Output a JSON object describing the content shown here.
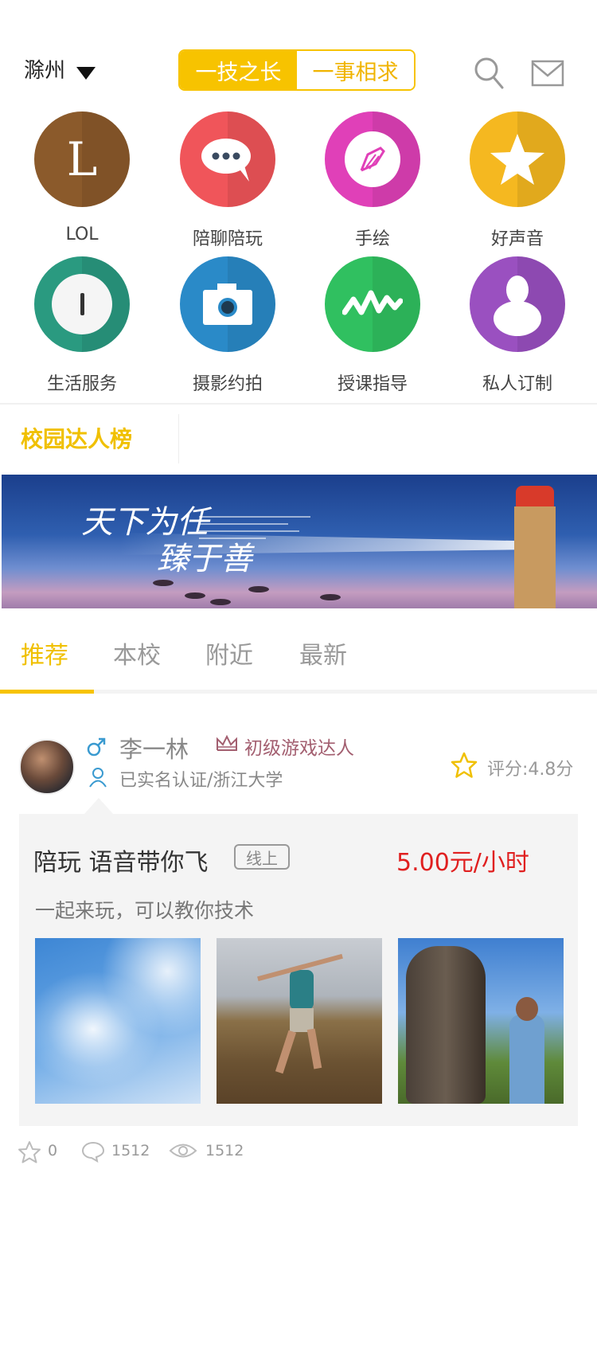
{
  "header": {
    "city": "滁州",
    "segment": {
      "active": "一技之长",
      "inactive": "一事相求"
    }
  },
  "categories": [
    {
      "label": "LOL",
      "icon": "lol-letter-icon",
      "color": "#8b5a2b",
      "glyph": "L"
    },
    {
      "label": "陪聊陪玩",
      "icon": "chat-bubble-icon",
      "color": "#f0555a"
    },
    {
      "label": "手绘",
      "icon": "pencil-icon",
      "color": "#e040b8"
    },
    {
      "label": "好声音",
      "icon": "star-icon",
      "color": "#f5b820"
    },
    {
      "label": "生活服务",
      "icon": "life-service-icon",
      "color": "#2a9a80"
    },
    {
      "label": "摄影约拍",
      "icon": "camera-icon",
      "color": "#2a8ac8"
    },
    {
      "label": "授课指导",
      "icon": "wave-icon",
      "color": "#30c060"
    },
    {
      "label": "私人订制",
      "icon": "person-icon",
      "color": "#9a50c0"
    }
  ],
  "rank": {
    "title": "校园达人榜"
  },
  "banner": {
    "line1": "天下为任",
    "line2": "臻于善"
  },
  "tabs": [
    "推荐",
    "本校",
    "附近",
    "最新"
  ],
  "post": {
    "username": "李一林",
    "level": "初级游戏达人",
    "verify": "已实名认证/浙江大学",
    "rating": "评分:4.8分",
    "title": "陪玩 语音带你飞",
    "badge": "线上",
    "price": "5.00元/小时",
    "desc": "一起来玩，可以教你技术",
    "likes": "0",
    "comments": "1512",
    "views": "1512"
  }
}
